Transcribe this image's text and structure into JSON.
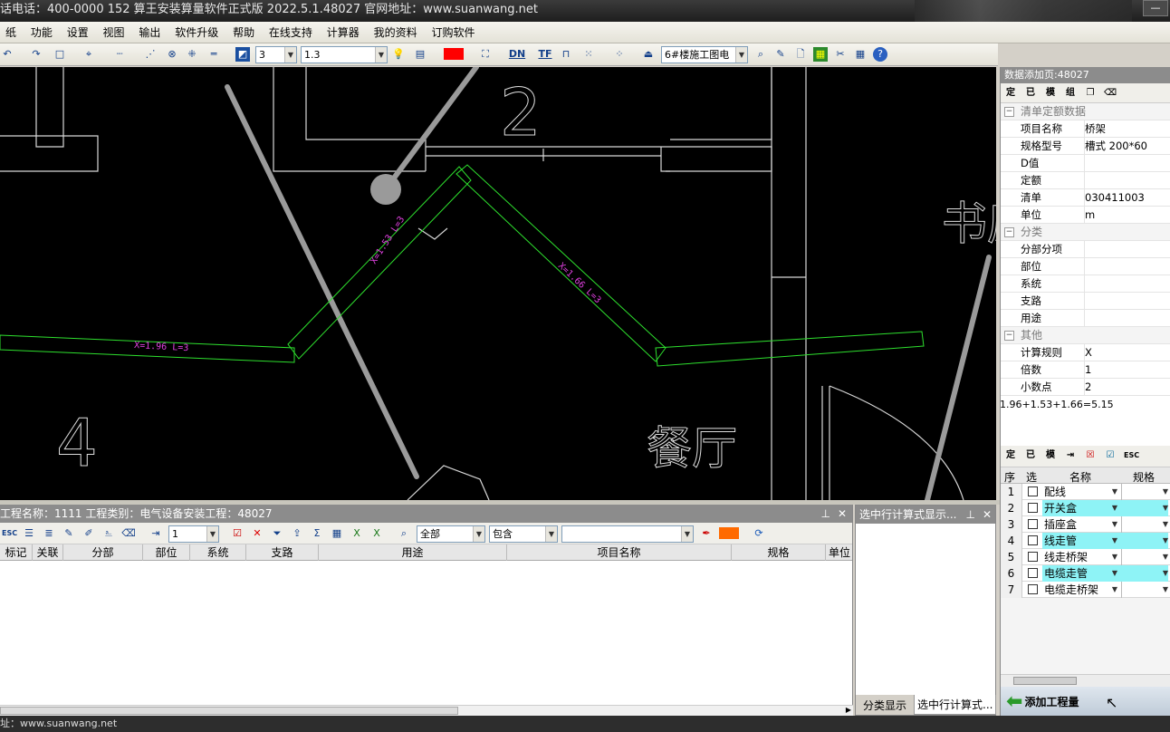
{
  "titlebar": {
    "text": "话电话：400-0000 152   算王安装算量软件正式版 2022.5.1.48027 官网地址：www.suanwang.net"
  },
  "menu": [
    "纸",
    "功能",
    "设置",
    "视图",
    "输出",
    "软件升级",
    "帮助",
    "在线支持",
    "计算器",
    "我的资料",
    "订购软件"
  ],
  "toolbar": {
    "linewidth": "3",
    "scale": "1.3",
    "drawing_name": "6#楼施工图电",
    "dn_label": "DN",
    "tf_label": "TF"
  },
  "cad": {
    "labels": [
      {
        "text": "X=1.53 L=3"
      },
      {
        "text": "X=1.66 L=3"
      },
      {
        "text": "X=1.96 L=3"
      }
    ],
    "numbers": {
      "two": "2",
      "four": "4"
    },
    "room": "餐厅",
    "side": "书房"
  },
  "right_panel": {
    "header": "数据添加页:48027",
    "tool_icons": [
      "定",
      "已",
      "模",
      "组"
    ],
    "sections": [
      {
        "title": "清单定额数据",
        "rows": [
          [
            "项目名称",
            "桥架"
          ],
          [
            "规格型号",
            "槽式 200*60"
          ],
          [
            "D值",
            ""
          ],
          [
            "定额",
            ""
          ],
          [
            "清单",
            "030411003"
          ],
          [
            "单位",
            "m"
          ]
        ]
      },
      {
        "title": "分类",
        "rows": [
          [
            "分部分项",
            ""
          ],
          [
            "部位",
            ""
          ],
          [
            "系统",
            ""
          ],
          [
            "支路",
            ""
          ],
          [
            "用途",
            ""
          ]
        ]
      },
      {
        "title": "其他",
        "rows": [
          [
            "计算规则",
            "X"
          ],
          [
            "倍数",
            "1"
          ],
          [
            "小数点",
            "2"
          ]
        ]
      }
    ],
    "formula": "1.96+1.53+1.66=5.15"
  },
  "type_list": {
    "tool_icons": [
      "定",
      "已",
      "模"
    ],
    "headers": {
      "seq": "序",
      "sel": "选",
      "name": "名称",
      "spec": "规格"
    },
    "rows": [
      {
        "n": "1",
        "name": "配线",
        "hl": false
      },
      {
        "n": "2",
        "name": "开关盒",
        "hl": true
      },
      {
        "n": "3",
        "name": "插座盒",
        "hl": false
      },
      {
        "n": "4",
        "name": "线走管",
        "hl": true
      },
      {
        "n": "5",
        "name": "线走桥架",
        "hl": false
      },
      {
        "n": "6",
        "name": "电缆走管",
        "hl": true
      },
      {
        "n": "7",
        "name": "电缆走桥架",
        "hl": false
      }
    ],
    "add_button": "添加工程量"
  },
  "bottom_left": {
    "header": "工程名称：1111  工程类别：电气设备安装工程：48027",
    "qty": "1",
    "filter_all": "全部",
    "filter_contains": "包含",
    "columns": [
      "标记",
      "关联",
      "分部",
      "部位",
      "系统",
      "支路",
      "用途",
      "项目名称",
      "规格",
      "单位"
    ]
  },
  "bottom_mid": {
    "header": "选中行计算式显示...",
    "tabs": [
      "分类显示",
      "选中行计算式..."
    ]
  },
  "status": {
    "text": "址：www.suanwang.net"
  },
  "colors": {
    "cad_bg": "#000000",
    "green_line": "#2ee02e",
    "magenta_text": "#e040e0",
    "highlight": "#8ef3f6"
  }
}
